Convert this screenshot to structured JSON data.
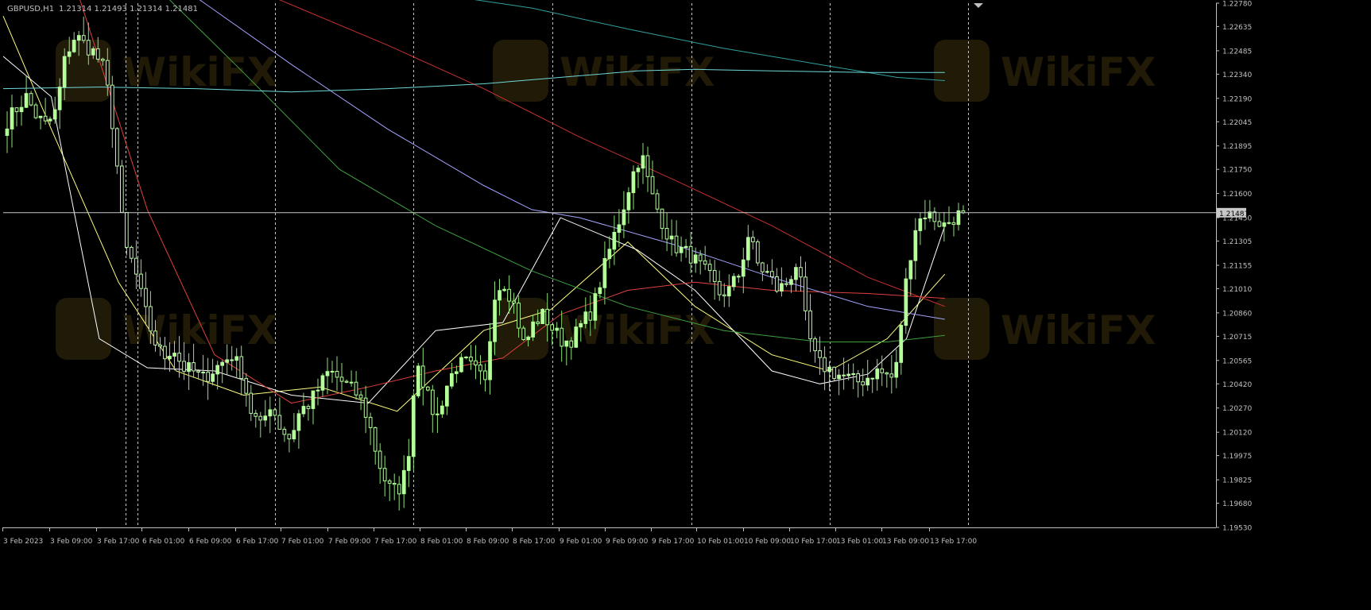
{
  "header": {
    "symbol": "GBPUSD,H1",
    "ohlc": "1.21314 1.21493 1.21314 1.21481"
  },
  "watermark": {
    "text": "WikiFX"
  },
  "colors": {
    "background": "#000000",
    "axis": "#c0c0c0",
    "text": "#c0c0c0",
    "bull_candle": "#b4ff9a",
    "bear_candle": "#000000",
    "wick": "#8ee078",
    "separator": "#c0c0c0",
    "price_line": "#c8c8c8"
  },
  "chart_data": {
    "type": "candlestick",
    "timeframe": "H1",
    "y_axis": {
      "min": 1.1953,
      "max": 1.2278,
      "ticks": [
        "1.22780",
        "1.22635",
        "1.22485",
        "1.22340",
        "1.22190",
        "1.22045",
        "1.21895",
        "1.21750",
        "1.21600",
        "1.21450",
        "1.21305",
        "1.21155",
        "1.21010",
        "1.20860",
        "1.20715",
        "1.20565",
        "1.20420",
        "1.20270",
        "1.20120",
        "1.19975",
        "1.19825",
        "1.19680",
        "1.19530"
      ],
      "current_price": "1.21481",
      "current_value": 1.21481
    },
    "x_axis": {
      "ticks": [
        "3 Feb 2023",
        "3 Feb 09:00",
        "3 Feb 17:00",
        "6 Feb 01:00",
        "6 Feb 09:00",
        "6 Feb 17:00",
        "7 Feb 01:00",
        "7 Feb 09:00",
        "7 Feb 17:00",
        "8 Feb 01:00",
        "8 Feb 09:00",
        "8 Feb 17:00",
        "9 Feb 01:00",
        "9 Feb 09:00",
        "9 Feb 17:00",
        "10 Feb 01:00",
        "10 Feb 09:00",
        "10 Feb 17:00",
        "13 Feb 01:00",
        "13 Feb 09:00",
        "13 Feb 17:00"
      ]
    },
    "day_separators": [
      "6 Feb 2023",
      "7 Feb 2023",
      "8 Feb 2023",
      "9 Feb 2023",
      "10 Feb 2023",
      "13 Feb 2023",
      "14 Feb 2023"
    ],
    "price_anchors": [
      1.2205,
      1.2213,
      1.222,
      1.2208,
      1.2202,
      1.2211,
      1.2246,
      1.2258,
      1.2252,
      1.2247,
      1.2236,
      1.2195,
      1.2128,
      1.2115,
      1.209,
      1.207,
      1.2058,
      1.2065,
      1.2052,
      1.205,
      1.2045,
      1.205,
      1.2055,
      1.206,
      1.205,
      1.2025,
      1.2015,
      1.203,
      1.2015,
      1.2008,
      1.2025,
      1.203,
      1.204,
      1.205,
      1.2045,
      1.204,
      1.2035,
      1.202,
      1.1995,
      1.1978,
      1.1975,
      1.199,
      1.206,
      1.2035,
      1.202,
      1.204,
      1.2053,
      1.2055,
      1.205,
      1.2042,
      1.21,
      1.2105,
      1.209,
      1.2065,
      1.208,
      1.2085,
      1.2075,
      1.2068,
      1.207,
      1.208,
      1.2088,
      1.211,
      1.213,
      1.2148,
      1.217,
      1.2185,
      1.216,
      1.2145,
      1.213,
      1.2125,
      1.2122,
      1.2115,
      1.2108,
      1.2098,
      1.21,
      1.211,
      1.2135,
      1.2115,
      1.211,
      1.21,
      1.2105,
      1.2118,
      1.2075,
      1.2055,
      1.2052,
      1.2048,
      1.2046,
      1.2043,
      1.2045,
      1.205,
      1.2048,
      1.2045,
      1.21,
      1.2138,
      1.2148,
      1.2145,
      1.214,
      1.2145,
      1.2148
    ],
    "series": [
      {
        "color": "#ffff80",
        "style": "moving-average",
        "x": [
          0,
          0.05,
          0.12,
          0.18,
          0.25,
          0.33,
          0.41,
          0.5,
          0.57,
          0.65,
          0.72,
          0.8,
          0.86,
          0.92,
          0.98
        ],
        "y": [
          1.227,
          1.22,
          1.2105,
          1.205,
          1.2035,
          1.204,
          1.2025,
          1.2075,
          1.2088,
          1.213,
          1.209,
          1.206,
          1.205,
          1.207,
          1.211
        ]
      },
      {
        "color": "#ffffff",
        "style": "moving-average",
        "x": [
          0,
          0.05,
          0.1,
          0.15,
          0.22,
          0.3,
          0.38,
          0.45,
          0.52,
          0.58,
          0.66,
          0.72,
          0.8,
          0.85,
          0.9,
          0.94,
          0.98
        ],
        "y": [
          1.2245,
          1.222,
          1.207,
          1.2052,
          1.205,
          1.2035,
          1.203,
          1.2075,
          1.208,
          1.2145,
          1.2125,
          1.21,
          1.205,
          1.2042,
          1.2048,
          1.207,
          1.214
        ]
      },
      {
        "color": "#e04040",
        "style": "moving-average",
        "x": [
          0.08,
          0.15,
          0.22,
          0.3,
          0.38,
          0.45,
          0.52,
          0.58,
          0.65,
          0.72,
          0.8,
          0.9,
          0.98
        ],
        "y": [
          1.228,
          1.215,
          1.206,
          1.203,
          1.204,
          1.205,
          1.2058,
          1.2085,
          1.21,
          1.2105,
          1.21,
          1.2098,
          1.2095
        ]
      },
      {
        "color": "#a4a4ff",
        "style": "moving-average",
        "x": [
          0.2,
          0.3,
          0.4,
          0.5,
          0.55,
          0.6,
          0.7,
          0.8,
          0.9,
          0.98
        ],
        "y": [
          1.2282,
          1.224,
          1.22,
          1.2165,
          1.215,
          1.2145,
          1.2128,
          1.2108,
          1.209,
          1.2082
        ]
      },
      {
        "color": "#40a040",
        "style": "moving-average",
        "x": [
          0.17,
          0.25,
          0.35,
          0.45,
          0.55,
          0.65,
          0.75,
          0.85,
          0.92,
          0.98
        ],
        "y": [
          1.2282,
          1.2235,
          1.2175,
          1.214,
          1.2112,
          1.209,
          1.2075,
          1.2068,
          1.2068,
          1.2072
        ]
      },
      {
        "color": "#c83030",
        "style": "moving-average",
        "x": [
          0.28,
          0.4,
          0.5,
          0.6,
          0.7,
          0.8,
          0.9,
          0.98
        ],
        "y": [
          1.2282,
          1.2252,
          1.2225,
          1.2195,
          1.2168,
          1.214,
          1.2108,
          1.209
        ]
      },
      {
        "color": "#30a0a0",
        "style": "moving-average",
        "x": [
          0.47,
          0.55,
          0.65,
          0.75,
          0.85,
          0.93,
          0.98
        ],
        "y": [
          1.2282,
          1.2275,
          1.2262,
          1.225,
          1.224,
          1.2232,
          1.223
        ]
      },
      {
        "color": "#70d8d8",
        "style": "moving-average",
        "x": [
          0,
          0.1,
          0.2,
          0.3,
          0.4,
          0.5,
          0.6,
          0.66,
          0.72,
          0.8,
          0.9,
          0.98
        ],
        "y": [
          1.2225,
          1.2226,
          1.2225,
          1.2223,
          1.2225,
          1.2228,
          1.2233,
          1.2236,
          1.2237,
          1.2236,
          1.2235,
          1.2235
        ]
      }
    ]
  }
}
